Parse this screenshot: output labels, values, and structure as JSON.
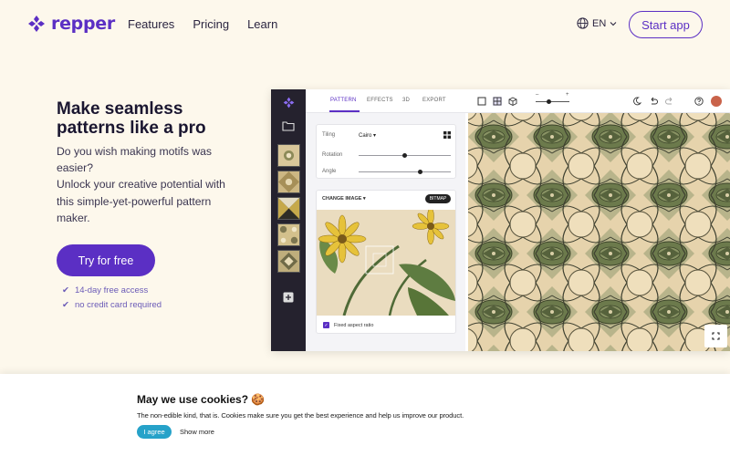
{
  "nav": {
    "brand": "repper",
    "links": [
      "Features",
      "Pricing",
      "Learn"
    ],
    "language": "EN",
    "start_app": "Start app"
  },
  "hero": {
    "title": "Make seamless patterns like a pro",
    "description_lines": [
      "Do you wish making motifs was",
      "easier?",
      "Unlock your creative potential with",
      "this simple-yet-powerful pattern",
      "maker."
    ],
    "cta": "Try for free",
    "perks": [
      "14-day free access",
      "no credit card required"
    ]
  },
  "app": {
    "tabs": [
      "PATTERN",
      "EFFECTS",
      "3D",
      "EXPORT"
    ],
    "active_tab": "PATTERN",
    "tiling_label": "Tiling",
    "tiling_value": "Cairo",
    "rotation_label": "Rotation",
    "rotation_value": 0.5,
    "angle_label": "Angle",
    "angle_value": 0.67,
    "change_image": "CHANGE IMAGE",
    "bitmap": "BITMAP",
    "aspect_label": "Fixed aspect ratio",
    "zoom_level": 0.4,
    "zoom_minus": "–",
    "zoom_plus": "+"
  },
  "cookie": {
    "title": "May we use cookies? 🍪",
    "text": "The non-edible kind, that is. Cookies make sure you get the best experience and help us improve our product.",
    "agree": "I agree",
    "show_more": "Show more"
  },
  "colors": {
    "brand": "#5b2fc4",
    "agree": "#26a2c9",
    "sidebar": "#25222e",
    "pattern_green": "#6c7a4c",
    "pattern_cream": "#ead9b5"
  }
}
